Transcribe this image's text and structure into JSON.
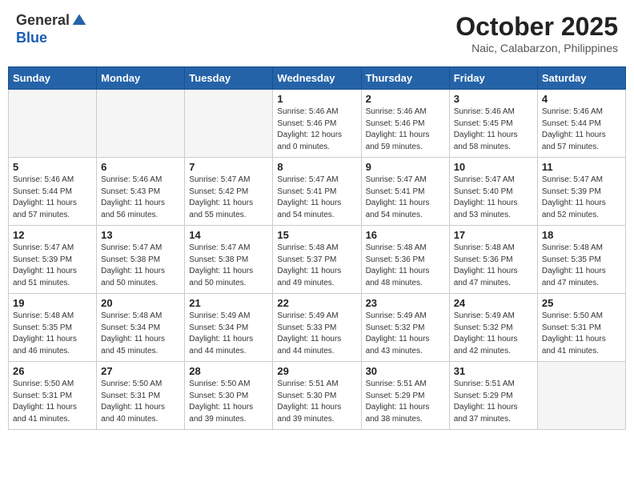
{
  "header": {
    "logo_line1": "General",
    "logo_line2": "Blue",
    "month": "October 2025",
    "location": "Naic, Calabarzon, Philippines"
  },
  "weekdays": [
    "Sunday",
    "Monday",
    "Tuesday",
    "Wednesday",
    "Thursday",
    "Friday",
    "Saturday"
  ],
  "weeks": [
    [
      {
        "day": "",
        "sunrise": "",
        "sunset": "",
        "daylight": ""
      },
      {
        "day": "",
        "sunrise": "",
        "sunset": "",
        "daylight": ""
      },
      {
        "day": "",
        "sunrise": "",
        "sunset": "",
        "daylight": ""
      },
      {
        "day": "1",
        "sunrise": "Sunrise: 5:46 AM",
        "sunset": "Sunset: 5:46 PM",
        "daylight": "Daylight: 12 hours and 0 minutes."
      },
      {
        "day": "2",
        "sunrise": "Sunrise: 5:46 AM",
        "sunset": "Sunset: 5:46 PM",
        "daylight": "Daylight: 11 hours and 59 minutes."
      },
      {
        "day": "3",
        "sunrise": "Sunrise: 5:46 AM",
        "sunset": "Sunset: 5:45 PM",
        "daylight": "Daylight: 11 hours and 58 minutes."
      },
      {
        "day": "4",
        "sunrise": "Sunrise: 5:46 AM",
        "sunset": "Sunset: 5:44 PM",
        "daylight": "Daylight: 11 hours and 57 minutes."
      }
    ],
    [
      {
        "day": "5",
        "sunrise": "Sunrise: 5:46 AM",
        "sunset": "Sunset: 5:44 PM",
        "daylight": "Daylight: 11 hours and 57 minutes."
      },
      {
        "day": "6",
        "sunrise": "Sunrise: 5:46 AM",
        "sunset": "Sunset: 5:43 PM",
        "daylight": "Daylight: 11 hours and 56 minutes."
      },
      {
        "day": "7",
        "sunrise": "Sunrise: 5:47 AM",
        "sunset": "Sunset: 5:42 PM",
        "daylight": "Daylight: 11 hours and 55 minutes."
      },
      {
        "day": "8",
        "sunrise": "Sunrise: 5:47 AM",
        "sunset": "Sunset: 5:41 PM",
        "daylight": "Daylight: 11 hours and 54 minutes."
      },
      {
        "day": "9",
        "sunrise": "Sunrise: 5:47 AM",
        "sunset": "Sunset: 5:41 PM",
        "daylight": "Daylight: 11 hours and 54 minutes."
      },
      {
        "day": "10",
        "sunrise": "Sunrise: 5:47 AM",
        "sunset": "Sunset: 5:40 PM",
        "daylight": "Daylight: 11 hours and 53 minutes."
      },
      {
        "day": "11",
        "sunrise": "Sunrise: 5:47 AM",
        "sunset": "Sunset: 5:39 PM",
        "daylight": "Daylight: 11 hours and 52 minutes."
      }
    ],
    [
      {
        "day": "12",
        "sunrise": "Sunrise: 5:47 AM",
        "sunset": "Sunset: 5:39 PM",
        "daylight": "Daylight: 11 hours and 51 minutes."
      },
      {
        "day": "13",
        "sunrise": "Sunrise: 5:47 AM",
        "sunset": "Sunset: 5:38 PM",
        "daylight": "Daylight: 11 hours and 50 minutes."
      },
      {
        "day": "14",
        "sunrise": "Sunrise: 5:47 AM",
        "sunset": "Sunset: 5:38 PM",
        "daylight": "Daylight: 11 hours and 50 minutes."
      },
      {
        "day": "15",
        "sunrise": "Sunrise: 5:48 AM",
        "sunset": "Sunset: 5:37 PM",
        "daylight": "Daylight: 11 hours and 49 minutes."
      },
      {
        "day": "16",
        "sunrise": "Sunrise: 5:48 AM",
        "sunset": "Sunset: 5:36 PM",
        "daylight": "Daylight: 11 hours and 48 minutes."
      },
      {
        "day": "17",
        "sunrise": "Sunrise: 5:48 AM",
        "sunset": "Sunset: 5:36 PM",
        "daylight": "Daylight: 11 hours and 47 minutes."
      },
      {
        "day": "18",
        "sunrise": "Sunrise: 5:48 AM",
        "sunset": "Sunset: 5:35 PM",
        "daylight": "Daylight: 11 hours and 47 minutes."
      }
    ],
    [
      {
        "day": "19",
        "sunrise": "Sunrise: 5:48 AM",
        "sunset": "Sunset: 5:35 PM",
        "daylight": "Daylight: 11 hours and 46 minutes."
      },
      {
        "day": "20",
        "sunrise": "Sunrise: 5:48 AM",
        "sunset": "Sunset: 5:34 PM",
        "daylight": "Daylight: 11 hours and 45 minutes."
      },
      {
        "day": "21",
        "sunrise": "Sunrise: 5:49 AM",
        "sunset": "Sunset: 5:34 PM",
        "daylight": "Daylight: 11 hours and 44 minutes."
      },
      {
        "day": "22",
        "sunrise": "Sunrise: 5:49 AM",
        "sunset": "Sunset: 5:33 PM",
        "daylight": "Daylight: 11 hours and 44 minutes."
      },
      {
        "day": "23",
        "sunrise": "Sunrise: 5:49 AM",
        "sunset": "Sunset: 5:32 PM",
        "daylight": "Daylight: 11 hours and 43 minutes."
      },
      {
        "day": "24",
        "sunrise": "Sunrise: 5:49 AM",
        "sunset": "Sunset: 5:32 PM",
        "daylight": "Daylight: 11 hours and 42 minutes."
      },
      {
        "day": "25",
        "sunrise": "Sunrise: 5:50 AM",
        "sunset": "Sunset: 5:31 PM",
        "daylight": "Daylight: 11 hours and 41 minutes."
      }
    ],
    [
      {
        "day": "26",
        "sunrise": "Sunrise: 5:50 AM",
        "sunset": "Sunset: 5:31 PM",
        "daylight": "Daylight: 11 hours and 41 minutes."
      },
      {
        "day": "27",
        "sunrise": "Sunrise: 5:50 AM",
        "sunset": "Sunset: 5:31 PM",
        "daylight": "Daylight: 11 hours and 40 minutes."
      },
      {
        "day": "28",
        "sunrise": "Sunrise: 5:50 AM",
        "sunset": "Sunset: 5:30 PM",
        "daylight": "Daylight: 11 hours and 39 minutes."
      },
      {
        "day": "29",
        "sunrise": "Sunrise: 5:51 AM",
        "sunset": "Sunset: 5:30 PM",
        "daylight": "Daylight: 11 hours and 39 minutes."
      },
      {
        "day": "30",
        "sunrise": "Sunrise: 5:51 AM",
        "sunset": "Sunset: 5:29 PM",
        "daylight": "Daylight: 11 hours and 38 minutes."
      },
      {
        "day": "31",
        "sunrise": "Sunrise: 5:51 AM",
        "sunset": "Sunset: 5:29 PM",
        "daylight": "Daylight: 11 hours and 37 minutes."
      },
      {
        "day": "",
        "sunrise": "",
        "sunset": "",
        "daylight": ""
      }
    ]
  ]
}
